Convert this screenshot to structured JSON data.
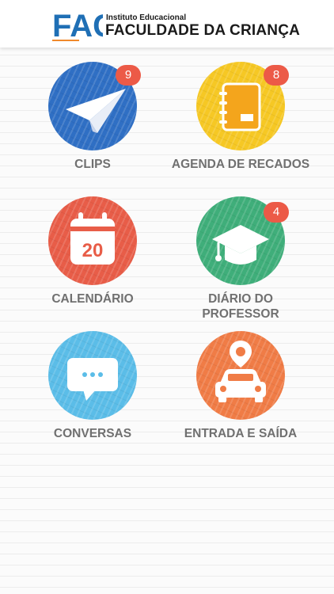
{
  "header": {
    "logo_text": "FAC",
    "subtitle": "Instituto Educacional",
    "title": "FACULDADE DA CRIANÇA"
  },
  "colors": {
    "clips": "#2f6fc4",
    "agenda": "#f6c824",
    "calendario": "#e85d48",
    "diario": "#3fae7a",
    "conversas": "#5bbde8",
    "entrada": "#f07c46",
    "badge": "#ec5a47"
  },
  "menu": [
    {
      "id": "clips",
      "label": "CLIPS",
      "badge": "9",
      "icon": "paper-plane-icon"
    },
    {
      "id": "agenda",
      "label": "AGENDA DE RECADOS",
      "badge": "8",
      "icon": "notebook-icon"
    },
    {
      "id": "calendario",
      "label": "CALENDÁRIO",
      "icon": "calendar-icon",
      "icon_text": "20"
    },
    {
      "id": "diario",
      "label_line1": "DIÁRIO DO",
      "label_line2": "PROFESSOR",
      "badge": "4",
      "icon": "graduation-cap-icon"
    },
    {
      "id": "conversas",
      "label": "CONVERSAS",
      "icon": "chat-bubble-icon"
    },
    {
      "id": "entrada",
      "label": "ENTRADA E SAÍDA",
      "icon": "car-location-icon"
    }
  ]
}
